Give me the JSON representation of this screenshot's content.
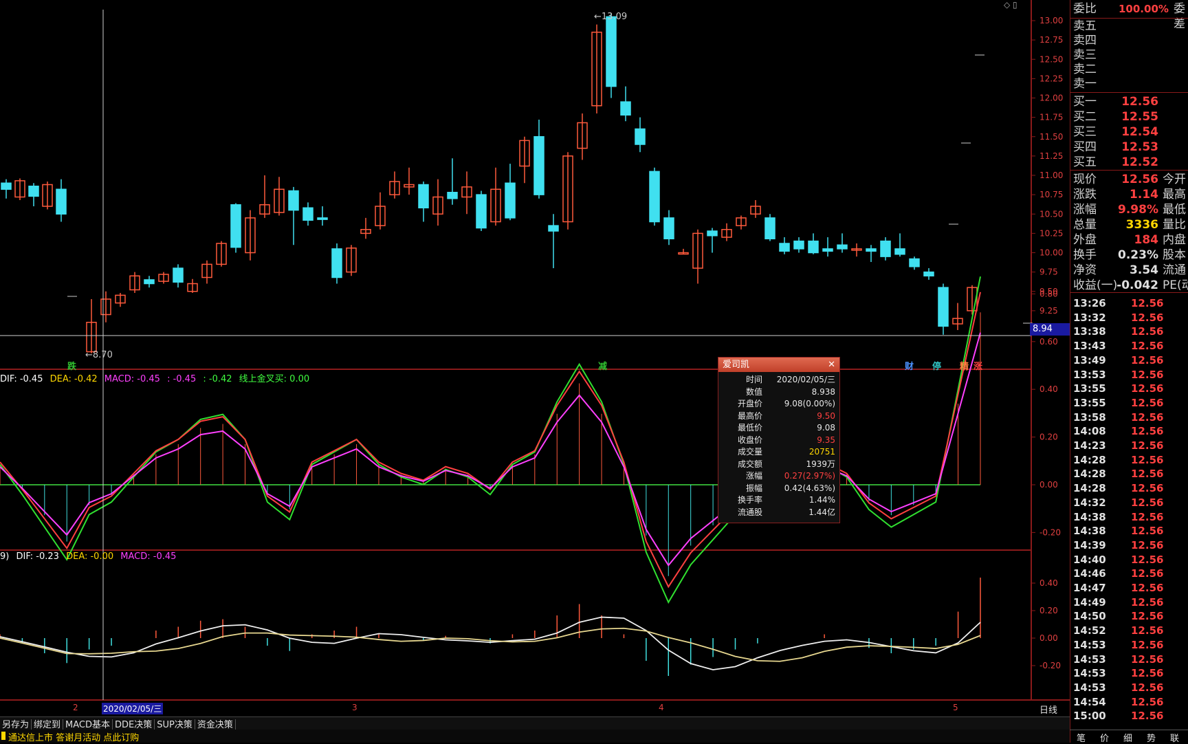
{
  "price_axis": [
    "13.00",
    "12.75",
    "12.50",
    "12.25",
    "12.00",
    "11.75",
    "11.50",
    "11.25",
    "11.00",
    "10.75",
    "10.50",
    "10.25",
    "10.00",
    "9.75",
    "9.50",
    "9.25"
  ],
  "price_highlight": "8.94",
  "peak_label": "13.09",
  "low_label": "8.70",
  "markers": [
    {
      "text": "跌",
      "color": "#30c030"
    },
    {
      "text": "减",
      "color": "#30c030"
    },
    {
      "text": "财",
      "color": "#4a90ff"
    },
    {
      "text": "停",
      "color": "#30c0c0"
    },
    {
      "text": "精",
      "color": "#ff8040"
    },
    {
      "text": "涨",
      "color": "#ff4040"
    }
  ],
  "macd1_legend": {
    "dif": "DIF: -0.45",
    "dea": "DEA: -0.42",
    "macd": "MACD: -0.45",
    "v1": ": -0.45",
    "v2": ": -0.42",
    "extra": "线上金叉买: 0.00"
  },
  "macd1_axis": [
    "0.80",
    "0.60",
    "0.40",
    "0.20",
    "0.00",
    "-0.20"
  ],
  "macd2_legend": {
    "prefix": "9)",
    "dif": "DIF: -0.23",
    "dea": "DEA: -0.00",
    "macd": "MACD: -0.45"
  },
  "macd2_axis": [
    "0.40",
    "0.20",
    "0.00",
    "-0.20"
  ],
  "date_axis": {
    "d1": "2",
    "d2": "3",
    "d3": "4",
    "d4": "5",
    "cursor": "2020/02/05/三",
    "period": "日线"
  },
  "popup": {
    "title": "爱司凯",
    "rows": [
      {
        "label": "时间",
        "value": "2020/02/05/三",
        "color": "#e8e8e8"
      },
      {
        "label": "数值",
        "value": "8.938",
        "color": "#e8e8e8"
      },
      {
        "label": "开盘价",
        "value": "9.08(0.00%)",
        "color": "#e8e8e8"
      },
      {
        "label": "最高价",
        "value": "9.50",
        "color": "#ff4040"
      },
      {
        "label": "最低价",
        "value": "9.08",
        "color": "#e8e8e8"
      },
      {
        "label": "收盘价",
        "value": "9.35",
        "color": "#ff4040"
      },
      {
        "label": "成交量",
        "value": "20751",
        "color": "#ffd700"
      },
      {
        "label": "成交额",
        "value": "1939万",
        "color": "#e8e8e8"
      },
      {
        "label": "涨幅",
        "value": "0.27(2.97%)",
        "color": "#ff4040"
      },
      {
        "label": "振幅",
        "value": "0.42(4.63%)",
        "color": "#e8e8e8"
      },
      {
        "label": "换手率",
        "value": "1.44%",
        "color": "#e8e8e8"
      },
      {
        "label": "流通股",
        "value": "1.44亿",
        "color": "#e8e8e8"
      }
    ]
  },
  "order_book": {
    "weibi_label": "委比",
    "weibi_value": "100.00%",
    "weibi_label2": "委差",
    "sells": [
      "卖五",
      "卖四",
      "卖三",
      "卖二",
      "卖一"
    ],
    "buys": [
      {
        "label": "买一",
        "price": "12.56"
      },
      {
        "label": "买二",
        "price": "12.55"
      },
      {
        "label": "买三",
        "price": "12.54"
      },
      {
        "label": "买四",
        "price": "12.53"
      },
      {
        "label": "买五",
        "price": "12.52"
      }
    ]
  },
  "quote": [
    {
      "label": "现价",
      "value": "12.56",
      "color": "#ff4040",
      "label2": "今开"
    },
    {
      "label": "涨跌",
      "value": "1.14",
      "color": "#ff4040",
      "label2": "最高"
    },
    {
      "label": "涨幅",
      "value": "9.98%",
      "color": "#ff4040",
      "label2": "最低"
    },
    {
      "label": "总量",
      "value": "3336",
      "color": "#ffd700",
      "label2": "量比"
    },
    {
      "label": "外盘",
      "value": "184",
      "color": "#ff4040",
      "label2": "内盘"
    },
    {
      "label": "换手",
      "value": "0.23%",
      "color": "#e0e0e0",
      "label2": "股本"
    },
    {
      "label": "净资",
      "value": "3.54",
      "color": "#e0e0e0",
      "label2": "流通"
    },
    {
      "label": "收益(一)",
      "value": "-0.042",
      "color": "#e0e0e0",
      "label2": "PE(动"
    }
  ],
  "ticks": [
    {
      "time": "13:26",
      "price": "12.56"
    },
    {
      "time": "13:32",
      "price": "12.56"
    },
    {
      "time": "13:38",
      "price": "12.56"
    },
    {
      "time": "13:43",
      "price": "12.56"
    },
    {
      "time": "13:49",
      "price": "12.56"
    },
    {
      "time": "13:53",
      "price": "12.56"
    },
    {
      "time": "13:55",
      "price": "12.56"
    },
    {
      "time": "13:55",
      "price": "12.56"
    },
    {
      "time": "13:58",
      "price": "12.56"
    },
    {
      "time": "14:08",
      "price": "12.56"
    },
    {
      "time": "14:23",
      "price": "12.56"
    },
    {
      "time": "14:28",
      "price": "12.56"
    },
    {
      "time": "14:28",
      "price": "12.56"
    },
    {
      "time": "14:28",
      "price": "12.56"
    },
    {
      "time": "14:32",
      "price": "12.56"
    },
    {
      "time": "14:38",
      "price": "12.56"
    },
    {
      "time": "14:38",
      "price": "12.56"
    },
    {
      "time": "14:39",
      "price": "12.56"
    },
    {
      "time": "14:40",
      "price": "12.56"
    },
    {
      "time": "14:46",
      "price": "12.56"
    },
    {
      "time": "14:47",
      "price": "12.56"
    },
    {
      "time": "14:49",
      "price": "12.56"
    },
    {
      "time": "14:50",
      "price": "12.56"
    },
    {
      "time": "14:52",
      "price": "12.56"
    },
    {
      "time": "14:53",
      "price": "12.56"
    },
    {
      "time": "14:53",
      "price": "12.56"
    },
    {
      "time": "14:53",
      "price": "12.56"
    },
    {
      "time": "14:53",
      "price": "12.56"
    },
    {
      "time": "14:54",
      "price": "12.56"
    },
    {
      "time": "15:00",
      "price": "12.56"
    }
  ],
  "toolbar": [
    "另存为",
    "绑定到",
    "MACD基本",
    "DDE决策",
    "SUP决策",
    "资金决策"
  ],
  "status_ticker": "通达信上市 答谢月活动 点此订购",
  "bottom_tabs": [
    "笔",
    "价",
    "细",
    "势",
    "联"
  ],
  "colors": {
    "up": "#ff5a3c",
    "down": "#40e0f0",
    "frame": "#8a1a1a"
  },
  "chart_data": {
    "type": "candlestick",
    "candles": [
      {
        "o": 10.9,
        "c": 10.82,
        "h": 10.95,
        "l": 10.7
      },
      {
        "o": 10.72,
        "c": 10.93,
        "h": 10.96,
        "l": 10.68
      },
      {
        "o": 10.86,
        "c": 10.73,
        "h": 10.9,
        "l": 10.6
      },
      {
        "o": 10.6,
        "c": 10.88,
        "h": 10.92,
        "l": 10.56
      },
      {
        "o": 10.82,
        "c": 10.5,
        "h": 10.95,
        "l": 10.4
      },
      {
        "o": 8.72,
        "c": 9.1,
        "h": 9.4,
        "l": 8.7
      },
      {
        "o": 9.2,
        "c": 9.4,
        "h": 9.5,
        "l": 9.1
      },
      {
        "o": 9.35,
        "c": 9.45,
        "h": 9.48,
        "l": 9.3
      },
      {
        "o": 9.52,
        "c": 9.7,
        "h": 9.75,
        "l": 9.48
      },
      {
        "o": 9.65,
        "c": 9.6,
        "h": 9.7,
        "l": 9.55
      },
      {
        "o": 9.63,
        "c": 9.72,
        "h": 9.75,
        "l": 9.6
      },
      {
        "o": 9.8,
        "c": 9.62,
        "h": 9.85,
        "l": 9.55
      },
      {
        "o": 9.5,
        "c": 9.6,
        "h": 9.66,
        "l": 9.48
      },
      {
        "o": 9.68,
        "c": 9.85,
        "h": 9.9,
        "l": 9.6
      },
      {
        "o": 9.85,
        "c": 10.12,
        "h": 10.15,
        "l": 9.82
      },
      {
        "o": 10.62,
        "c": 10.07,
        "h": 10.64,
        "l": 10.0
      },
      {
        "o": 10.0,
        "c": 10.45,
        "h": 10.55,
        "l": 9.9
      },
      {
        "o": 10.5,
        "c": 10.62,
        "h": 11.0,
        "l": 10.45
      },
      {
        "o": 10.52,
        "c": 10.82,
        "h": 10.98,
        "l": 10.48
      },
      {
        "o": 10.8,
        "c": 10.55,
        "h": 10.85,
        "l": 10.1
      },
      {
        "o": 10.58,
        "c": 10.42,
        "h": 10.65,
        "l": 10.35
      },
      {
        "o": 10.45,
        "c": 10.43,
        "h": 10.6,
        "l": 10.35
      },
      {
        "o": 10.05,
        "c": 9.68,
        "h": 10.12,
        "l": 9.6
      },
      {
        "o": 9.75,
        "c": 10.06,
        "h": 10.1,
        "l": 9.7
      },
      {
        "o": 10.25,
        "c": 10.3,
        "h": 10.45,
        "l": 10.18
      },
      {
        "o": 10.35,
        "c": 10.6,
        "h": 10.78,
        "l": 10.3
      },
      {
        "o": 10.75,
        "c": 10.92,
        "h": 11.05,
        "l": 10.7
      },
      {
        "o": 10.85,
        "c": 10.88,
        "h": 11.1,
        "l": 10.75
      },
      {
        "o": 10.88,
        "c": 10.58,
        "h": 10.92,
        "l": 10.4
      },
      {
        "o": 10.5,
        "c": 10.72,
        "h": 10.95,
        "l": 10.35
      },
      {
        "o": 10.78,
        "c": 10.7,
        "h": 11.22,
        "l": 10.62
      },
      {
        "o": 10.72,
        "c": 10.85,
        "h": 11.05,
        "l": 10.5
      },
      {
        "o": 10.75,
        "c": 10.32,
        "h": 10.8,
        "l": 10.28
      },
      {
        "o": 10.4,
        "c": 10.82,
        "h": 11.1,
        "l": 10.35
      },
      {
        "o": 10.9,
        "c": 10.45,
        "h": 11.15,
        "l": 10.42
      },
      {
        "o": 11.12,
        "c": 11.45,
        "h": 11.5,
        "l": 10.9
      },
      {
        "o": 11.5,
        "c": 10.75,
        "h": 11.72,
        "l": 10.7
      },
      {
        "o": 10.35,
        "c": 10.28,
        "h": 10.5,
        "l": 9.8
      },
      {
        "o": 10.4,
        "c": 11.25,
        "h": 11.3,
        "l": 10.3
      },
      {
        "o": 11.35,
        "c": 11.68,
        "h": 11.8,
        "l": 11.2
      },
      {
        "o": 11.9,
        "c": 12.85,
        "h": 12.95,
        "l": 11.8
      },
      {
        "o": 13.05,
        "c": 12.15,
        "h": 13.09,
        "l": 12.0
      },
      {
        "o": 11.95,
        "c": 11.78,
        "h": 12.15,
        "l": 11.7
      },
      {
        "o": 11.6,
        "c": 11.4,
        "h": 11.75,
        "l": 11.3
      },
      {
        "o": 11.05,
        "c": 10.4,
        "h": 11.1,
        "l": 10.35
      },
      {
        "o": 10.45,
        "c": 10.18,
        "h": 10.55,
        "l": 10.1
      },
      {
        "o": 10.0,
        "c": 10.0,
        "h": 10.05,
        "l": 9.98
      },
      {
        "o": 9.8,
        "c": 10.25,
        "h": 10.3,
        "l": 9.6
      },
      {
        "o": 10.28,
        "c": 10.22,
        "h": 10.32,
        "l": 10.0
      },
      {
        "o": 10.2,
        "c": 10.3,
        "h": 10.38,
        "l": 10.15
      },
      {
        "o": 10.35,
        "c": 10.45,
        "h": 10.48,
        "l": 10.3
      },
      {
        "o": 10.5,
        "c": 10.6,
        "h": 10.68,
        "l": 10.45
      },
      {
        "o": 10.45,
        "c": 10.18,
        "h": 10.5,
        "l": 10.15
      },
      {
        "o": 10.12,
        "c": 10.02,
        "h": 10.2,
        "l": 9.98
      },
      {
        "o": 10.15,
        "c": 10.05,
        "h": 10.2,
        "l": 10.0
      },
      {
        "o": 10.15,
        "c": 10.0,
        "h": 10.25,
        "l": 9.98
      },
      {
        "o": 10.05,
        "c": 10.02,
        "h": 10.2,
        "l": 9.95
      },
      {
        "o": 10.1,
        "c": 10.05,
        "h": 10.25,
        "l": 10.0
      },
      {
        "o": 10.05,
        "c": 10.05,
        "h": 10.12,
        "l": 9.95
      },
      {
        "o": 10.05,
        "c": 10.02,
        "h": 10.1,
        "l": 9.88
      },
      {
        "o": 10.15,
        "c": 9.95,
        "h": 10.2,
        "l": 9.9
      },
      {
        "o": 10.05,
        "c": 9.98,
        "h": 10.25,
        "l": 9.95
      },
      {
        "o": 9.92,
        "c": 9.82,
        "h": 9.95,
        "l": 9.78
      },
      {
        "o": 9.75,
        "c": 9.7,
        "h": 9.8,
        "l": 9.65
      },
      {
        "o": 9.55,
        "c": 9.05,
        "h": 9.6,
        "l": 8.94
      },
      {
        "o": 9.08,
        "c": 9.15,
        "h": 9.35,
        "l": 9.0
      },
      {
        "o": 9.25,
        "c": 9.55,
        "h": 9.58,
        "l": 9.2
      }
    ],
    "macd_histogram": [
      0.1,
      -0.02,
      -0.15,
      -0.28,
      -0.1,
      -0.05,
      0.05,
      0.15,
      0.2,
      0.28,
      0.3,
      0.2,
      -0.05,
      -0.12,
      0.1,
      0.15,
      0.2,
      0.1,
      0.05,
      0.02,
      0.08,
      0.05,
      -0.02,
      0.1,
      0.15,
      0.35,
      0.5,
      0.35,
      0.1,
      -0.25,
      -0.45,
      -0.3,
      -0.2,
      -0.1,
      -0.02,
      0.05,
      0.05,
      0.1,
      0.05,
      -0.08,
      -0.15,
      -0.1,
      -0.05,
      0.4,
      0.85
    ]
  }
}
